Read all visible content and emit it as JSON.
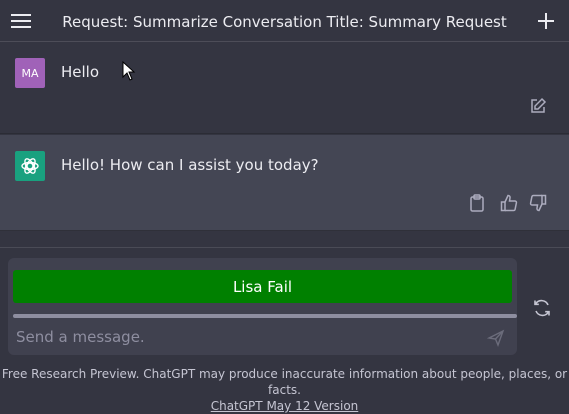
{
  "header": {
    "title": "Request: Summarize Conversation Title: Summary Request",
    "menu_icon": "hamburger-menu-icon",
    "new_chat_icon": "plus-icon"
  },
  "messages": [
    {
      "role": "user",
      "avatar": "MA",
      "text": "Hello"
    },
    {
      "role": "assistant",
      "avatar_icon": "openai-logo-icon",
      "text": "Hello! How can I assist you today?"
    }
  ],
  "composer": {
    "button_label": "Lisa Fail",
    "button_color": "#008000",
    "placeholder": "Send a message.",
    "send_icon": "send-icon",
    "regenerate_icon": "refresh-icon"
  },
  "footer": {
    "text": "Free Research Preview. ChatGPT may produce inaccurate information about people, places, or facts.",
    "link": "ChatGPT May 12 Version"
  },
  "colors": {
    "background": "#343541",
    "assistant_row": "#444654",
    "user_avatar": "#a062b8",
    "assistant_avatar": "#19a17f"
  }
}
